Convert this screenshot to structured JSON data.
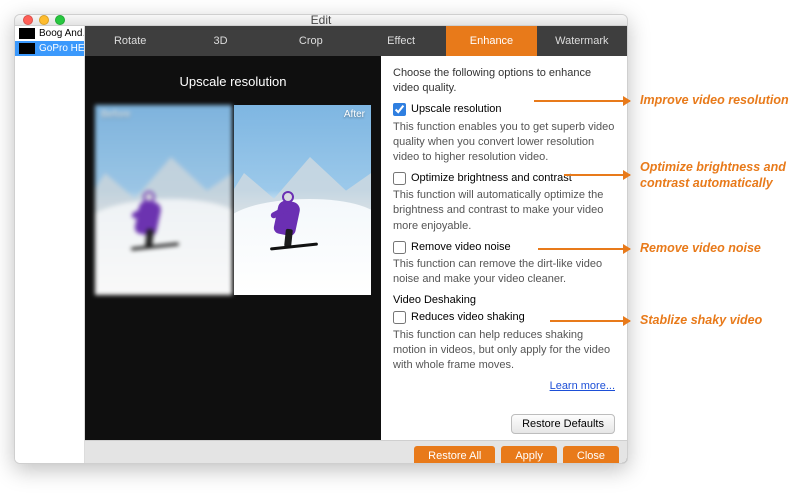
{
  "window": {
    "title": "Edit"
  },
  "sidebar": {
    "items": [
      {
        "label": "Boog And…"
      },
      {
        "label": "GoPro HE…"
      }
    ]
  },
  "tabs": {
    "items": [
      {
        "label": "Rotate"
      },
      {
        "label": "3D"
      },
      {
        "label": "Crop"
      },
      {
        "label": "Effect"
      },
      {
        "label": "Enhance"
      },
      {
        "label": "Watermark"
      }
    ],
    "active": "Enhance"
  },
  "preview": {
    "heading": "Upscale resolution",
    "before_label": "Before",
    "after_label": "After"
  },
  "panel": {
    "lead": "Choose the following options to enhance video quality.",
    "opt1": {
      "label": "Upscale resolution",
      "desc": "This function enables you to get superb video quality when you convert lower resolution video to higher resolution video."
    },
    "opt2": {
      "label": "Optimize brightness and contrast",
      "desc": "This function will automatically optimize the brightness and contrast to make your video more enjoyable."
    },
    "opt3": {
      "label": "Remove video noise",
      "desc": "This function can remove the dirt-like video noise and make your video cleaner."
    },
    "deshake_head": "Video Deshaking",
    "opt4": {
      "label": "Reduces video shaking",
      "desc": "This function can help reduces shaking motion in videos, but only apply for the video with whole frame moves."
    },
    "learn_more": "Learn more...",
    "restore_defaults": "Restore Defaults"
  },
  "bottom": {
    "restore_all": "Restore All",
    "apply": "Apply",
    "close": "Close"
  },
  "annotations": {
    "a1": "Improve video resolution",
    "a2": "Optimize brightness and contrast automatically",
    "a3": "Remove video noise",
    "a4": "Stablize shaky video"
  }
}
